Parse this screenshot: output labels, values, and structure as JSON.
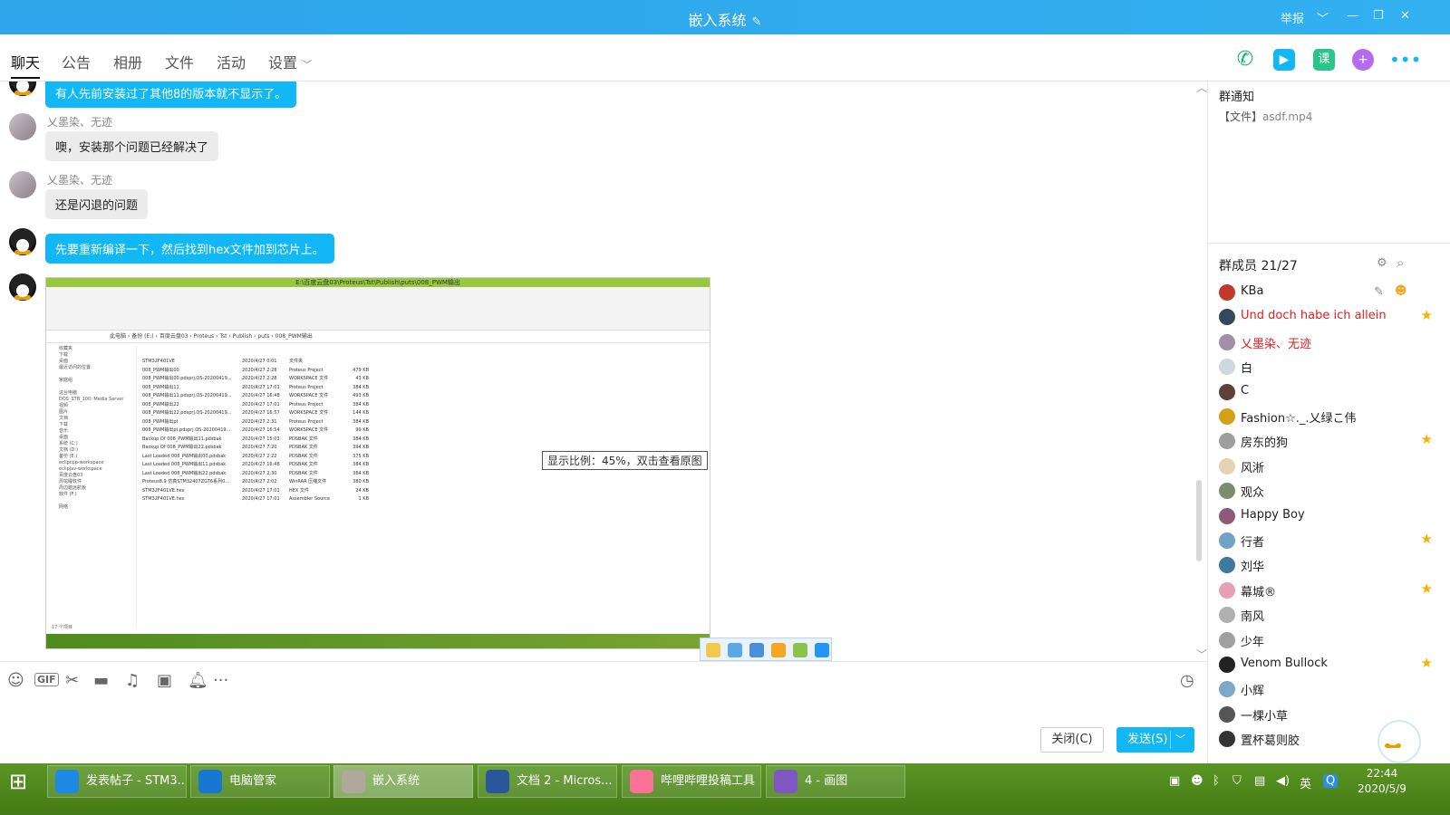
{
  "window": {
    "title": "嵌入系统",
    "report_label": "举报"
  },
  "tabs": [
    {
      "label": "聊天"
    },
    {
      "label": "公告"
    },
    {
      "label": "相册"
    },
    {
      "label": "文件"
    },
    {
      "label": "活动"
    },
    {
      "label": "设置"
    }
  ],
  "messages": [
    {
      "sender": "",
      "text": "有人先前安装过了其他8的版本就不显示了。",
      "style": "blue"
    },
    {
      "sender": "乂墨染、无迹",
      "text": "噢，安装那个问题已经解决了",
      "style": "gray"
    },
    {
      "sender": "乂墨染、无迹",
      "text": "还是闪退的问题",
      "style": "gray"
    },
    {
      "sender": "",
      "text": "先要重新编译一下，然后找到hex文件加到芯片上。",
      "style": "blue"
    }
  ],
  "screenshot": {
    "window_title": "E:\\百度云盘03\\Proteus\\Tst\\Publish\\puts\\008_PWM输出",
    "address": "此电脑 › 备份 (E:) › 百度云盘03 › Proteus › Tst › Publish › puts › 008_PWM输出",
    "zoom_tip": "显示比例：45%，双击查看原图",
    "nav_items": [
      "收藏夹",
      "下载",
      "桌面",
      "最近访问的位置",
      "",
      "家庭组",
      "",
      "这台电脑",
      "DOS_STB_100: Media Server",
      "视频",
      "图片",
      "文档",
      "下载",
      "音乐",
      "桌面",
      "系统 (C:)",
      "文档 (D:)",
      "备份 (E:)",
      "eclipcpp-workspace",
      "eclipjav-workspace",
      "百度云盘03",
      "周花睡软件",
      "周边踏远航板",
      "软件 (F:)",
      "",
      "网络"
    ],
    "files": [
      {
        "name": "STM32F401VE",
        "date": "2020/4/27 0:01",
        "type": "文件夹",
        "size": ""
      },
      {
        "name": "008_PWM输出00",
        "date": "2020/4/27 2:28",
        "type": "Proteus Project",
        "size": "479 KB"
      },
      {
        "name": "008_PWM输出00.pdsprj.OS-20200419...",
        "date": "2020/4/27 2:28",
        "type": "WORKSPACE 文件",
        "size": "43 KB"
      },
      {
        "name": "008_PWM输出11",
        "date": "2020/4/27 17:01",
        "type": "Proteus Project",
        "size": "384 KB"
      },
      {
        "name": "008_PWM输出11.pdsprj.OS-20200419...",
        "date": "2020/4/27 16:48",
        "type": "WORKSPACE 文件",
        "size": "493 KB"
      },
      {
        "name": "008_PWM输出22",
        "date": "2020/4/27 17:01",
        "type": "Proteus Project",
        "size": "384 KB"
      },
      {
        "name": "008_PWM输出22.pdsprj.OS-20200419...",
        "date": "2020/4/27 16:57",
        "type": "WORKSPACE 文件",
        "size": "144 KB"
      },
      {
        "name": "008_PWM输出pt",
        "date": "2020/4/27 2:31",
        "type": "Proteus Project",
        "size": "384 KB"
      },
      {
        "name": "008_PWM输出pt.pdsprj.OS-20200419...",
        "date": "2020/4/27 16:54",
        "type": "WORKSPACE 文件",
        "size": "99 KB"
      },
      {
        "name": "Backup Of 008_PWM输出11.pdsbak",
        "date": "2020/4/27 15:03",
        "type": "PDSBAK 文件",
        "size": "384 KB"
      },
      {
        "name": "Backup Of 008_PWM输出22.pdsbak",
        "date": "2020/4/27 7:20",
        "type": "PDSBAK 文件",
        "size": "394 KB"
      },
      {
        "name": "Last Loaded 008_PWM输出00.pdsbak",
        "date": "2020/4/27 2:22",
        "type": "PDSBAK 文件",
        "size": "375 KB"
      },
      {
        "name": "Last Loaded 008_PWM输出11.pdsbak",
        "date": "2020/4/27 16:48",
        "type": "PDSBAK 文件",
        "size": "384 KB"
      },
      {
        "name": "Last Loaded 008_PWM输出22.pdsbak",
        "date": "2020/4/27 2:30",
        "type": "PDSBAK 文件",
        "size": "384 KB"
      },
      {
        "name": "Proteus8.9 仿真STM32407ZGT6系列0...",
        "date": "2020/4/27 2:02",
        "type": "WinRAR 压缩文件",
        "size": "380 KB"
      },
      {
        "name": "STM32F401VE.hex",
        "date": "2020/4/27 17:01",
        "type": "HEX 文件",
        "size": "24 KB"
      },
      {
        "name": "STM32F401VE.hex",
        "date": "2020/4/27 17:01",
        "type": "Assembler Source",
        "size": "1 KB"
      }
    ],
    "item_count": "17 个项目"
  },
  "input": {
    "close_label": "关闭(C)",
    "send_label": "发送(S)"
  },
  "notice": {
    "title": "群通知",
    "prefix": "【文件】",
    "filename": "asdf.mp4"
  },
  "members": {
    "title": "群成员 21/27",
    "list": [
      {
        "name": "KBa",
        "star": false,
        "red": false,
        "color": "#c0392b"
      },
      {
        "name": "Und doch habe ich allein",
        "star": true,
        "red": true,
        "color": "#34495e"
      },
      {
        "name": "乂墨染、无迹",
        "star": false,
        "red": true,
        "color": "#a58ea9"
      },
      {
        "name": "白",
        "star": false,
        "red": false,
        "color": "#cfd8dc"
      },
      {
        "name": "C",
        "star": false,
        "red": false,
        "color": "#5d4037"
      },
      {
        "name": "Fashion☆._.乂绿こ伟",
        "star": false,
        "red": false,
        "color": "#d4a017"
      },
      {
        "name": "房东的狗",
        "star": true,
        "red": false,
        "color": "#9e9e9e"
      },
      {
        "name": "风淅",
        "star": false,
        "red": false,
        "color": "#e6d3b3"
      },
      {
        "name": "观众",
        "star": false,
        "red": false,
        "color": "#7b8d6e"
      },
      {
        "name": "Happy Boy",
        "star": false,
        "red": false,
        "color": "#8e5a7a"
      },
      {
        "name": "行者",
        "star": true,
        "red": false,
        "color": "#6fa3c7"
      },
      {
        "name": "刘华",
        "star": false,
        "red": false,
        "color": "#3d7a9e"
      },
      {
        "name": "幕城®",
        "star": true,
        "red": false,
        "color": "#e8a0b4"
      },
      {
        "name": "南风",
        "star": false,
        "red": false,
        "color": "#b0b0b0"
      },
      {
        "name": "少年",
        "star": false,
        "red": false,
        "color": "#a0a0a0"
      },
      {
        "name": "Venom Bullock",
        "star": true,
        "red": false,
        "color": "#222222"
      },
      {
        "name": "小辉",
        "star": false,
        "red": false,
        "color": "#7fa7c9"
      },
      {
        "name": "一棵小草",
        "star": false,
        "red": false,
        "color": "#555555"
      },
      {
        "name": "置杯葛则胶",
        "star": false,
        "red": false,
        "color": "#333333"
      }
    ]
  },
  "taskbar": {
    "items": [
      {
        "label": "发表帖子 - STM3...",
        "color": "#1e88e5",
        "active": false
      },
      {
        "label": "电脑管家",
        "color": "#1976d2",
        "active": false
      },
      {
        "label": "嵌入系统",
        "color": "#b0a89a",
        "active": true
      },
      {
        "label": "文档 2 - Micros...",
        "color": "#2b579a",
        "active": false
      },
      {
        "label": "哔哩哔哩投稿工具",
        "color": "#fb7299",
        "active": false
      },
      {
        "label": "4 - 画图",
        "color": "#7e57c2",
        "active": false
      }
    ],
    "ime": "英",
    "time": "22:44",
    "date": "2020/5/9"
  }
}
